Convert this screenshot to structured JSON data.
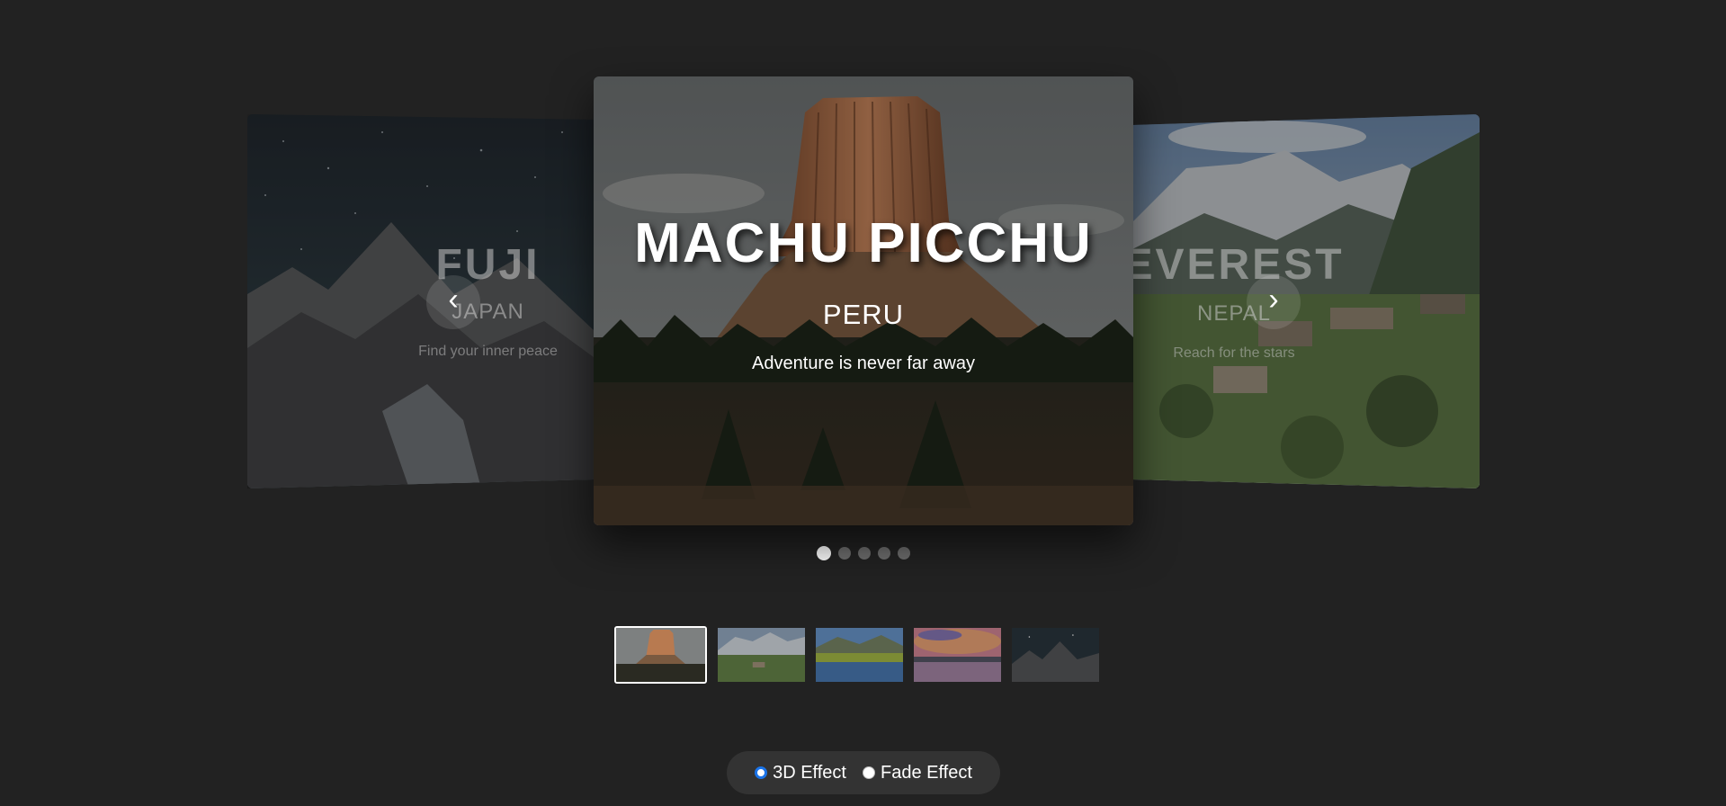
{
  "slides": {
    "left": {
      "title": "FUJI",
      "subtitle": "JAPAN",
      "tagline": "Find your inner peace",
      "scene_icon": "mountain-night-image"
    },
    "center": {
      "title": "MACHU PICCHU",
      "subtitle": "PERU",
      "tagline": "Adventure is never far away",
      "scene_icon": "rock-tower-image"
    },
    "right": {
      "title": "EVEREST",
      "subtitle": "NEPAL",
      "tagline": "Reach for the stars",
      "scene_icon": "mountain-village-image"
    }
  },
  "navigation": {
    "prev_label": "‹",
    "next_label": "›",
    "prev_icon": "chevron-left-icon",
    "next_icon": "chevron-right-icon"
  },
  "pagination": {
    "count": 5,
    "active_index": 0
  },
  "thumbnails": [
    {
      "name": "rock-tower-thumb",
      "active": true
    },
    {
      "name": "mountain-village-thumb",
      "active": false
    },
    {
      "name": "lake-valley-thumb",
      "active": false
    },
    {
      "name": "sunset-lake-thumb",
      "active": false
    },
    {
      "name": "night-mountain-thumb",
      "active": false
    }
  ],
  "effects": {
    "options": [
      {
        "label": "3D Effect",
        "checked": true
      },
      {
        "label": "Fade Effect",
        "checked": false
      }
    ]
  },
  "colors": {
    "background": "#222222",
    "accent": "#1a73e8",
    "dot_inactive": "#6e6e6e"
  }
}
